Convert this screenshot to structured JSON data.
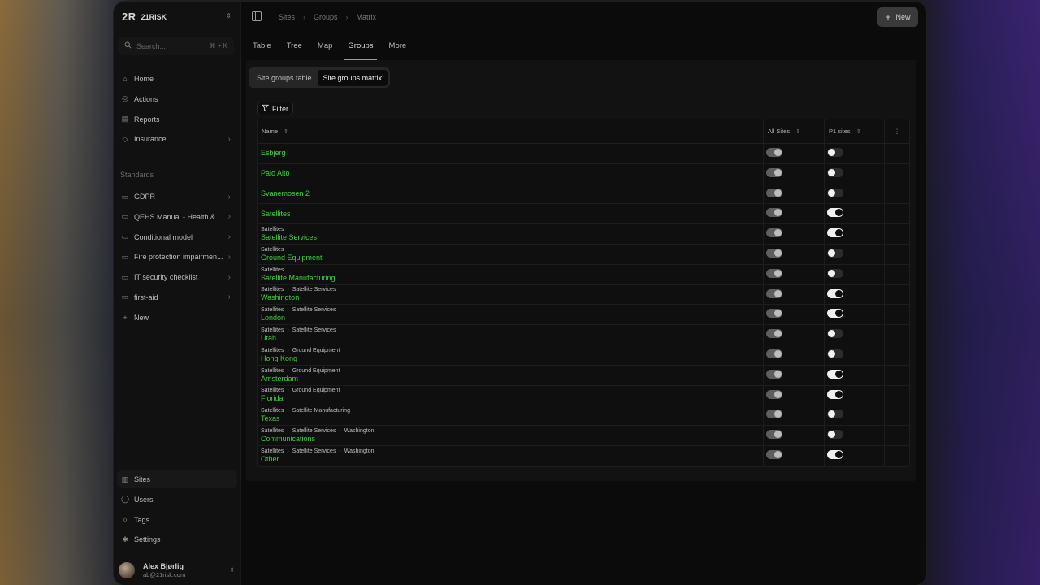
{
  "brand": {
    "logo": "2R",
    "name": "21RISK"
  },
  "search": {
    "placeholder": "Search...",
    "shortcut": "⌘ + K"
  },
  "nav": [
    {
      "label": "Home",
      "icon": "home-icon",
      "chevron": false
    },
    {
      "label": "Actions",
      "icon": "bell-icon",
      "chevron": false
    },
    {
      "label": "Reports",
      "icon": "report-icon",
      "chevron": false
    },
    {
      "label": "Insurance",
      "icon": "shield-icon",
      "chevron": true
    }
  ],
  "standards_label": "Standards",
  "standards": [
    {
      "label": "GDPR",
      "icon": "document-icon",
      "chevron": true
    },
    {
      "label": "QEHS Manual - Health & ...",
      "icon": "document-icon",
      "chevron": true
    },
    {
      "label": "Conditional model",
      "icon": "document-icon",
      "chevron": true
    },
    {
      "label": "Fire protection impairmen...",
      "icon": "document-icon",
      "chevron": true
    },
    {
      "label": "IT security checklist",
      "icon": "document-icon",
      "chevron": true
    },
    {
      "label": "first-aid",
      "icon": "document-icon",
      "chevron": true
    },
    {
      "label": "New",
      "icon": "plus-icon",
      "chevron": false
    }
  ],
  "bottom_nav": [
    {
      "label": "Sites",
      "icon": "building-icon",
      "active": true
    },
    {
      "label": "Users",
      "icon": "user-icon",
      "active": false
    },
    {
      "label": "Tags",
      "icon": "tag-icon",
      "active": false
    },
    {
      "label": "Settings",
      "icon": "gear-icon",
      "active": false
    }
  ],
  "user": {
    "name": "Alex Bjørlig",
    "email": "ab@21risk.com"
  },
  "breadcrumbs": [
    "Sites",
    "Groups",
    "Matrix"
  ],
  "new_button": "New",
  "tabs": [
    "Table",
    "Tree",
    "Map",
    "Groups",
    "More"
  ],
  "active_tab": "Groups",
  "segments": [
    "Site groups table",
    "Site groups matrix"
  ],
  "active_segment": "Site groups matrix",
  "filter_label": "Filter",
  "columns": {
    "name": "Name",
    "all_sites": "All Sites",
    "p1_sites": "P1 sites"
  },
  "rows": [
    {
      "path": [],
      "name": "Esbjerg",
      "all": true,
      "p1": false
    },
    {
      "path": [],
      "name": "Palo Alto",
      "all": true,
      "p1": false
    },
    {
      "path": [],
      "name": "Svanemosen 2",
      "all": true,
      "p1": false
    },
    {
      "path": [],
      "name": "Satellites",
      "all": true,
      "p1": true
    },
    {
      "path": [
        "Satellites"
      ],
      "name": "Satellite Services",
      "all": true,
      "p1": true
    },
    {
      "path": [
        "Satellites"
      ],
      "name": "Ground Equipment",
      "all": true,
      "p1": false
    },
    {
      "path": [
        "Satellites"
      ],
      "name": "Satellite Manufacturing",
      "all": true,
      "p1": false
    },
    {
      "path": [
        "Satellites",
        "Satellite Services"
      ],
      "name": "Washington",
      "all": true,
      "p1": true
    },
    {
      "path": [
        "Satellites",
        "Satellite Services"
      ],
      "name": "London",
      "all": true,
      "p1": true
    },
    {
      "path": [
        "Satellites",
        "Satellite Services"
      ],
      "name": "Utah",
      "all": true,
      "p1": false
    },
    {
      "path": [
        "Satellites",
        "Ground Equipment"
      ],
      "name": "Hong Kong",
      "all": true,
      "p1": false
    },
    {
      "path": [
        "Satellites",
        "Ground Equipment"
      ],
      "name": "Amsterdam",
      "all": true,
      "p1": true
    },
    {
      "path": [
        "Satellites",
        "Ground Equipment"
      ],
      "name": "Florida",
      "all": true,
      "p1": true
    },
    {
      "path": [
        "Satellites",
        "Satellite Manufacturing"
      ],
      "name": "Texas",
      "all": true,
      "p1": false
    },
    {
      "path": [
        "Satellites",
        "Satellite Services",
        "Washington"
      ],
      "name": "Communications",
      "all": true,
      "p1": false
    },
    {
      "path": [
        "Satellites",
        "Satellite Services",
        "Washington"
      ],
      "name": "Other",
      "all": true,
      "p1": true
    }
  ]
}
